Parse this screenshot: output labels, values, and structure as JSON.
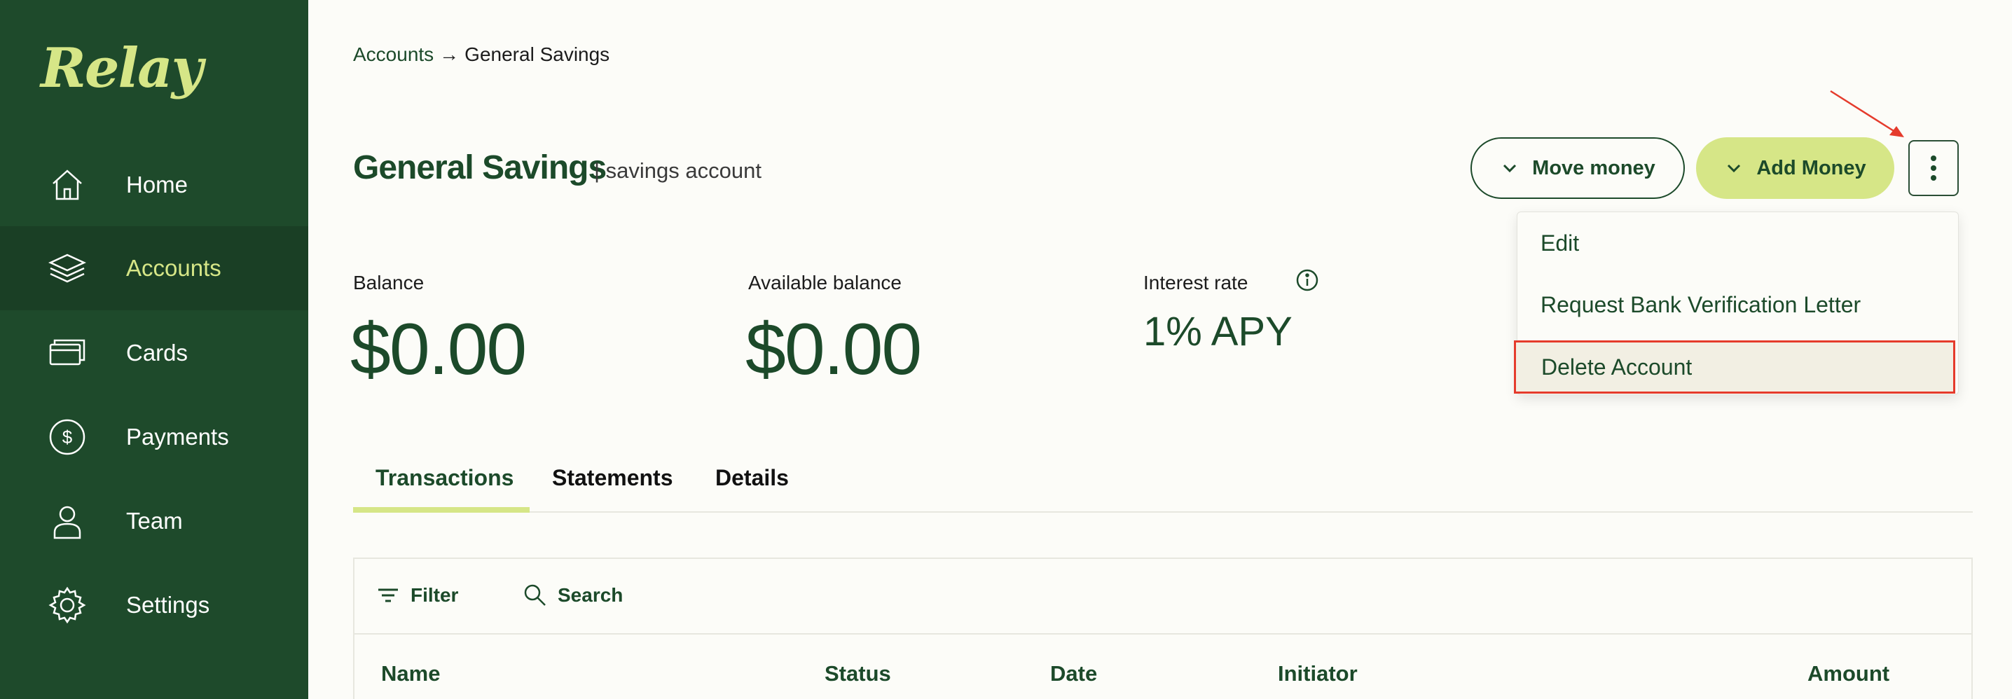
{
  "sidebar": {
    "logo": "Relay",
    "items": [
      {
        "label": "Home",
        "icon": "home-icon"
      },
      {
        "label": "Accounts",
        "icon": "layers-icon"
      },
      {
        "label": "Cards",
        "icon": "cards-icon"
      },
      {
        "label": "Payments",
        "icon": "dollar-circle-icon"
      },
      {
        "label": "Team",
        "icon": "person-icon"
      },
      {
        "label": "Settings",
        "icon": "gear-icon"
      }
    ],
    "active": "Accounts"
  },
  "breadcrumb": {
    "parent": "Accounts",
    "separator": "→",
    "current": "General Savings"
  },
  "header": {
    "title": "General Savings",
    "subtitle": "| savings account",
    "move_money": "Move money",
    "add_money": "Add Money"
  },
  "menu": {
    "items": [
      "Edit",
      "Request Bank Verification Letter",
      "Delete Account"
    ]
  },
  "stats": {
    "balance_label": "Balance",
    "balance_value": "$0.00",
    "available_label": "Available balance",
    "available_value": "$0.00",
    "interest_label": "Interest rate",
    "interest_value": "1% APY"
  },
  "tabs": [
    "Transactions",
    "Statements",
    "Details"
  ],
  "table": {
    "filter": "Filter",
    "search": "Search",
    "columns": [
      "Name",
      "Status",
      "Date",
      "Initiator",
      "Amount"
    ]
  },
  "colors": {
    "sidebar": "#1e4a2b",
    "accent": "#d6e687",
    "text_green": "#1c4a2a",
    "highlight": "#e53b2c"
  }
}
